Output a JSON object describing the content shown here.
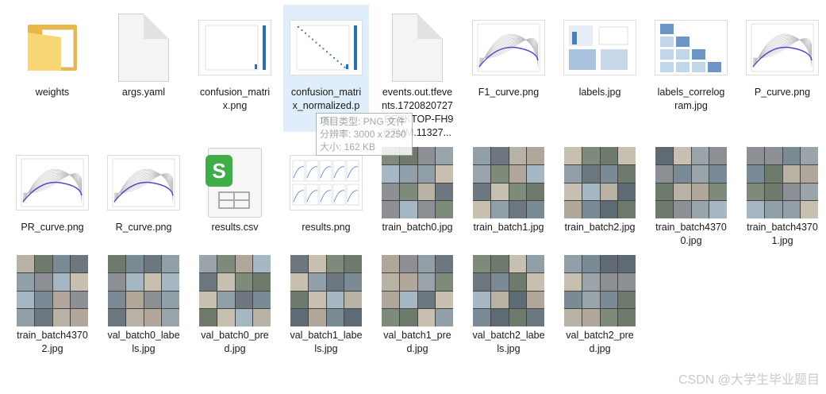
{
  "files": [
    {
      "name": "weights",
      "kind": "folder"
    },
    {
      "name": "args.yaml",
      "kind": "doc"
    },
    {
      "name": "confusion_matri\nx.png",
      "kind": "chart-matrix"
    },
    {
      "name": "confusion_matri\nx_normalized.p\nng",
      "kind": "chart-matrix-norm",
      "selected": true
    },
    {
      "name": "events.out.tfeve\nnts.1720820727\n.DESKTOP-FH9\nGTMM.11327...",
      "kind": "doc"
    },
    {
      "name": "F1_curve.png",
      "kind": "chart-curve"
    },
    {
      "name": "labels.jpg",
      "kind": "chart-labels"
    },
    {
      "name": "labels_correlog\nram.jpg",
      "kind": "chart-correlogram"
    },
    {
      "name": "P_curve.png",
      "kind": "chart-curve"
    },
    {
      "name": "PR_curve.png",
      "kind": "chart-curve"
    },
    {
      "name": "R_curve.png",
      "kind": "chart-curve"
    },
    {
      "name": "results.csv",
      "kind": "sheet"
    },
    {
      "name": "results.png",
      "kind": "chart-results"
    },
    {
      "name": "train_batch0.jpg",
      "kind": "photo"
    },
    {
      "name": "train_batch1.jpg",
      "kind": "photo"
    },
    {
      "name": "train_batch2.jpg",
      "kind": "photo"
    },
    {
      "name": "train_batch4370\n0.jpg",
      "kind": "photo"
    },
    {
      "name": "train_batch4370\n1.jpg",
      "kind": "photo"
    },
    {
      "name": "train_batch4370\n2.jpg",
      "kind": "photo"
    },
    {
      "name": "val_batch0_labe\nls.jpg",
      "kind": "photo"
    },
    {
      "name": "val_batch0_pre\nd.jpg",
      "kind": "photo"
    },
    {
      "name": "val_batch1_labe\nls.jpg",
      "kind": "photo"
    },
    {
      "name": "val_batch1_pre\nd.jpg",
      "kind": "photo"
    },
    {
      "name": "val_batch2_labe\nls.jpg",
      "kind": "photo"
    },
    {
      "name": "val_batch2_pre\nd.jpg",
      "kind": "photo"
    }
  ],
  "tooltip": {
    "type_line": "项目类型: PNG 文件",
    "size_line": "分辨率: 3000 x 2250",
    "filesize_line": "大小: 162 KB"
  },
  "watermark": "CSDN @大学生毕业题目",
  "colors": {
    "selection": "#dfeefa",
    "folder": "#f8d675",
    "sheet_badge": "#3fae49"
  }
}
